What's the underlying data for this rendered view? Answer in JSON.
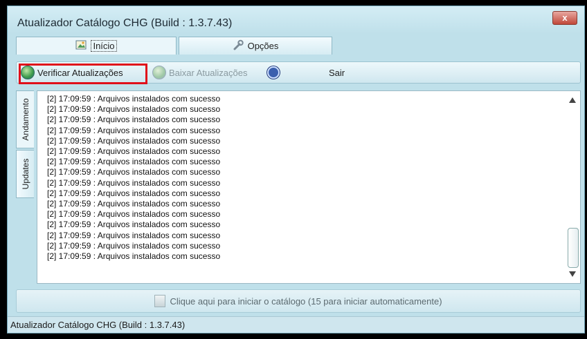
{
  "window": {
    "title": "Atualizador Catálogo CHG  (Build : 1.3.7.43)",
    "close_label": "x"
  },
  "tabs": [
    {
      "label": "Início",
      "icon": "image-icon"
    },
    {
      "label": "Opções",
      "icon": "wrench-icon"
    }
  ],
  "toolbar": {
    "verificar_label": "Verificar Atualizações",
    "baixar_label": "Baixar Atualizações",
    "sair_label": "Sair"
  },
  "side_tabs": [
    "Andamento",
    "Updates"
  ],
  "log_lines": [
    "[2] 17:09:59 : Arquivos instalados com sucesso",
    "[2] 17:09:59 : Arquivos instalados com sucesso",
    "[2] 17:09:59 : Arquivos instalados com sucesso",
    "[2] 17:09:59 : Arquivos instalados com sucesso",
    "[2] 17:09:59 : Arquivos instalados com sucesso",
    "[2] 17:09:59 : Arquivos instalados com sucesso",
    "[2] 17:09:59 : Arquivos instalados com sucesso",
    "[2] 17:09:59 : Arquivos instalados com sucesso",
    "[2] 17:09:59 : Arquivos instalados com sucesso",
    "[2] 17:09:59 : Arquivos instalados com sucesso",
    "[2] 17:09:59 : Arquivos instalados com sucesso",
    "[2] 17:09:59 : Arquivos instalados com sucesso",
    "[2] 17:09:59 : Arquivos instalados com sucesso",
    "[2] 17:09:59 : Arquivos instalados com sucesso",
    "[2] 17:09:59 : Arquivos instalados com sucesso",
    "[2] 17:09:59 : Arquivos instalados com sucesso"
  ],
  "start_button": {
    "label": "Clique aqui para iniciar o catálogo (15 para iniciar automaticamente)"
  },
  "status_bar": {
    "text": "Atualizador Catálogo CHG  (Build : 1.3.7.43)"
  },
  "colors": {
    "highlight": "#e0101a",
    "window_bg": "#bfe0ea"
  }
}
